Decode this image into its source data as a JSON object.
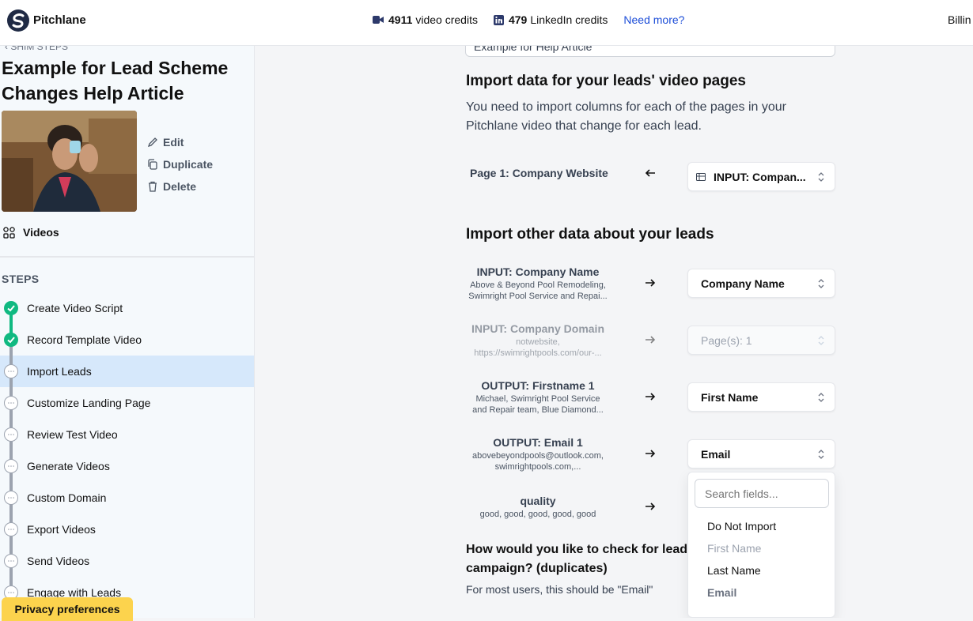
{
  "topbar": {
    "brand": "Pitchlane",
    "video_credits_count": "4911",
    "video_credits_label": "video credits",
    "linkedin_credits_count": "479",
    "linkedin_credits_label": "LinkedIn credits",
    "need_more": "Need more?",
    "billing": "Billin"
  },
  "sidebar": {
    "back_link": "‹ SHIM STEPS",
    "project_title": "Example for Lead Scheme Changes Help Article",
    "actions": {
      "edit": "Edit",
      "duplicate": "Duplicate",
      "delete": "Delete"
    },
    "videos": "Videos",
    "steps_heading": "STEPS",
    "steps": [
      {
        "label": "Create Video Script",
        "status": "done"
      },
      {
        "label": "Record Template Video",
        "status": "done"
      },
      {
        "label": "Import Leads",
        "status": "active"
      },
      {
        "label": "Customize Landing Page",
        "status": "pending"
      },
      {
        "label": "Review Test Video",
        "status": "pending"
      },
      {
        "label": "Generate Videos",
        "status": "pending"
      },
      {
        "label": "Custom Domain",
        "status": "pending"
      },
      {
        "label": "Export Videos",
        "status": "pending"
      },
      {
        "label": "Send Videos",
        "status": "pending"
      },
      {
        "label": "Engage with Leads",
        "status": "pending"
      }
    ],
    "privacy": "Privacy preferences"
  },
  "main": {
    "top_input_value": "Example for Help Article",
    "video_pages": {
      "title": "Import data for your leads' video pages",
      "description": "You need to import columns for each of the pages in your Pitchlane video that change for each lead.",
      "page_label": "Page 1: Company Website",
      "page_select": "INPUT: Compan..."
    },
    "other_data": {
      "title": "Import other data about your leads",
      "rows": [
        {
          "label": "INPUT: Company Name",
          "sub1": "Above & Beyond Pool Remodeling,",
          "sub2": "Swimright Pool Service and Repai...",
          "select": "Company Name"
        },
        {
          "label": "INPUT: Company Domain",
          "sub1": "notwebsite,",
          "sub2": "https://swimrightpools.com/our-...",
          "select": "Page(s): 1"
        },
        {
          "label": "OUTPUT: Firstname 1",
          "sub1": "Michael, Swimright Pool Service",
          "sub2": "and Repair team, Blue Diamond...",
          "select": "First Name"
        },
        {
          "label": "OUTPUT: Email 1",
          "sub1": "abovebeyondpools@outlook.com,",
          "sub2": "swimrightpools.com,...",
          "select": "Email"
        },
        {
          "label": "quality",
          "sub1": "good, good, good, good, good",
          "sub2": ""
        }
      ]
    },
    "dropdown": {
      "search_placeholder": "Search fields...",
      "options": [
        "Do Not Import",
        "First Name",
        "Last Name",
        "Email"
      ]
    },
    "duplicates": {
      "title": "How would you like to check for leads campaign? (duplicates)",
      "note": "For most users, this should be \"Email\""
    }
  }
}
